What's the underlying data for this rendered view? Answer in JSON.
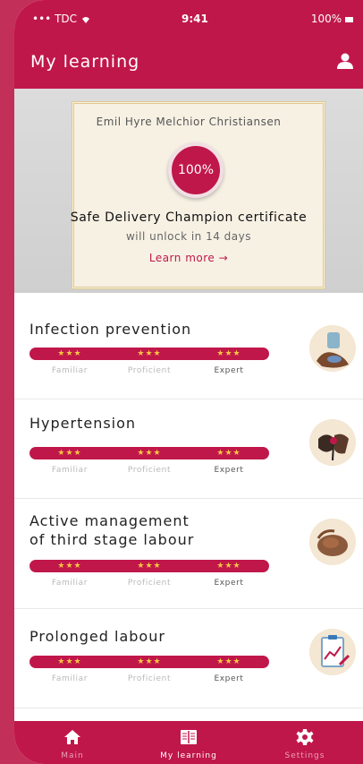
{
  "status": {
    "carrier": "TDC",
    "time": "9:41",
    "battery": "100%"
  },
  "header": {
    "title": "My learning"
  },
  "certificate": {
    "name": "Emil Hyre Melchior Christiansen",
    "progress": "100%",
    "title": "Safe Delivery Champion certificate",
    "subtitle": "will unlock in 14 days",
    "link": "Learn more  →"
  },
  "levels": [
    "Familiar",
    "Proficient",
    "Expert"
  ],
  "stars": "★★★",
  "modules": [
    {
      "title": "Infection prevention"
    },
    {
      "title": "Hypertension"
    },
    {
      "title": "Active management\nof third stage labour"
    },
    {
      "title": "Prolonged labour"
    }
  ],
  "tabs": [
    {
      "label": "Main"
    },
    {
      "label": "My learning"
    },
    {
      "label": "Settings"
    }
  ],
  "colors": {
    "brand": "#c0174a",
    "star": "#f5c542"
  }
}
